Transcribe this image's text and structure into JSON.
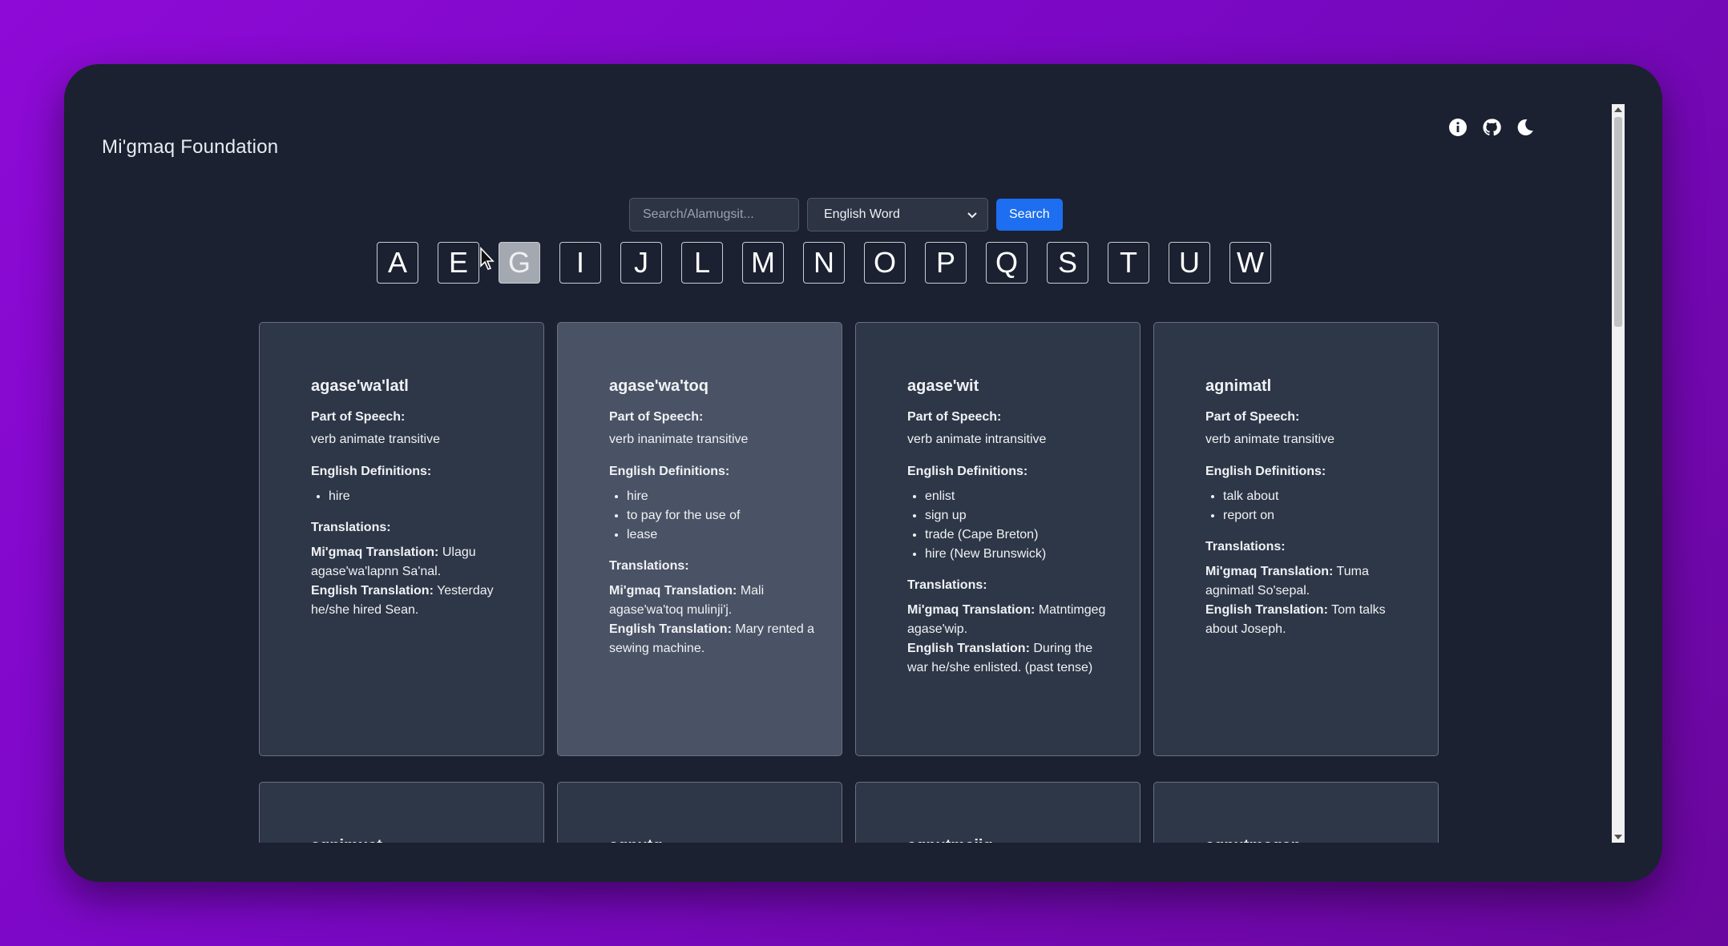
{
  "header": {
    "brand": "Mi'gmaq Foundation",
    "icons": [
      "info-icon",
      "github-icon",
      "moon-icon"
    ]
  },
  "search": {
    "placeholder": "Search/Alamugsit...",
    "select_value": "English Word",
    "button": "Search"
  },
  "letters": [
    "A",
    "E",
    "G",
    "I",
    "J",
    "L",
    "M",
    "N",
    "O",
    "P",
    "Q",
    "S",
    "T",
    "U",
    "W"
  ],
  "active_letter": "G",
  "labels": {
    "pos": "Part of Speech:",
    "defs": "English Definitions:",
    "trans": "Translations:",
    "migmaq": "Mi'gmaq Translation:",
    "english": "English Translation:"
  },
  "cards": [
    {
      "word": "agase'wa'latl",
      "pos": "verb animate transitive",
      "defs": [
        "hire"
      ],
      "migmaq": "Ulagu agase'wa'lapnn Sa'nal.",
      "english": "Yesterday he/she hired Sean."
    },
    {
      "word": "agase'wa'toq",
      "pos": "verb inanimate transitive",
      "defs": [
        "hire",
        "to pay for the use of",
        "lease"
      ],
      "migmaq": "Mali agase'wa'toq mulinji'j.",
      "english": "Mary rented a sewing machine."
    },
    {
      "word": "agase'wit",
      "pos": "verb animate intransitive",
      "defs": [
        "enlist",
        "sign up",
        "trade (Cape Breton)",
        "hire (New Brunswick)"
      ],
      "migmaq": "Matntimgeg agase'wip.",
      "english": "During the war he/she enlisted. (past tense)"
    },
    {
      "word": "agnimatl",
      "pos": "verb animate transitive",
      "defs": [
        "talk about",
        "report on"
      ],
      "migmaq": "Tuma agnimatl So'sepal.",
      "english": "Tom talks about Joseph."
    }
  ],
  "next_cards": [
    "agnimuet",
    "agnutg",
    "agnutmajig",
    "agnutmaqan"
  ]
}
